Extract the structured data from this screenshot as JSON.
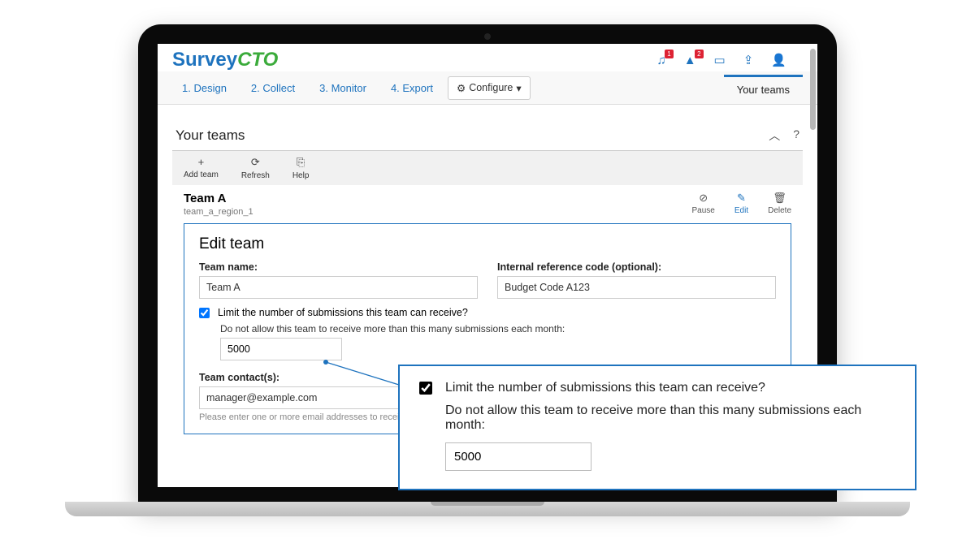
{
  "logo": {
    "part1": "Survey",
    "part2": "CTO"
  },
  "header_badges": {
    "notif1": "1",
    "notif2": "2"
  },
  "nav": {
    "design": "1. Design",
    "collect": "2. Collect",
    "monitor": "3. Monitor",
    "export": "4. Export",
    "configure": "Configure",
    "right_tab": "Your teams"
  },
  "panel": {
    "title": "Your teams"
  },
  "toolbar": {
    "add": "Add team",
    "refresh": "Refresh",
    "help": "Help"
  },
  "team": {
    "name": "Team A",
    "id": "team_a_region_1",
    "actions": {
      "pause": "Pause",
      "edit": "Edit",
      "delete": "Delete"
    }
  },
  "edit": {
    "heading": "Edit team",
    "team_name_label": "Team name:",
    "team_name_value": "Team A",
    "ref_label": "Internal reference code (optional):",
    "ref_value": "Budget Code A123",
    "limit_check_label": "Limit the number of submissions this team can receive?",
    "limit_desc": "Do not allow this team to receive more than this many submissions each month:",
    "limit_value": "5000",
    "contact_label": "Team contact(s):",
    "contact_value": "manager@example.com",
    "contact_help": "Please enter one or more email addresses to receive email notificat"
  },
  "callout": {
    "check_label": "Limit the number of submissions this team can receive?",
    "desc": "Do not allow this team to receive more than this many submissions each month:",
    "value": "5000"
  }
}
